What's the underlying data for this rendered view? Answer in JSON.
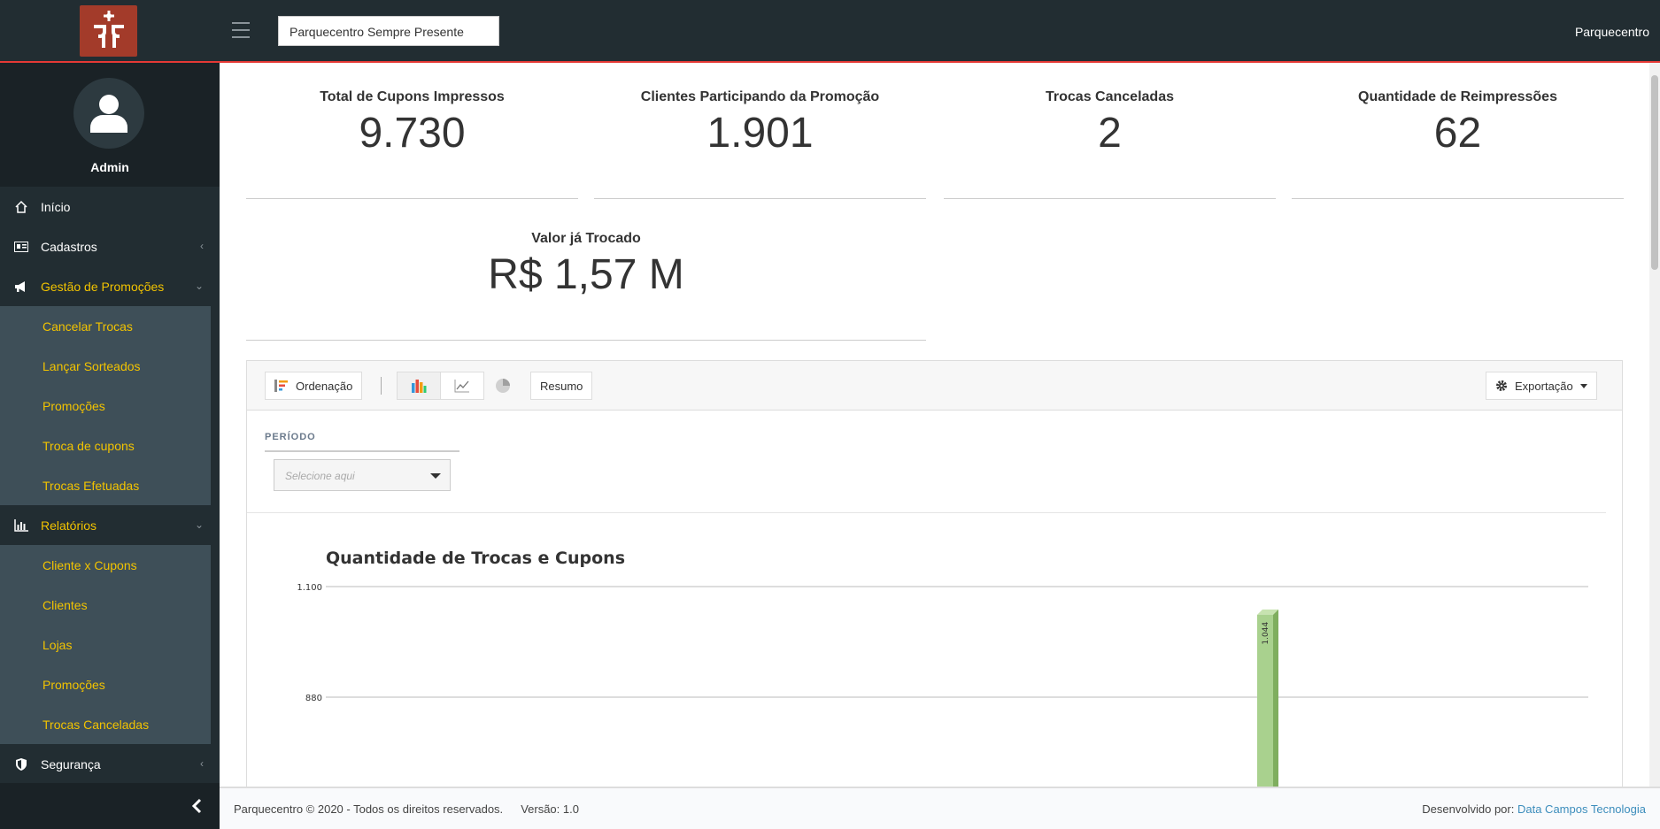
{
  "header": {
    "org_select": "Parquecentro Sempre Presente",
    "user_label": "Parquecentro"
  },
  "sidebar": {
    "user_name": "Admin",
    "items": [
      {
        "label": "Início",
        "icon": "home-icon",
        "expandable": false,
        "active": false
      },
      {
        "label": "Cadastros",
        "icon": "id-card-icon",
        "expandable": true,
        "active": false
      },
      {
        "label": "Gestão de Promoções",
        "icon": "megaphone-icon",
        "expandable": true,
        "active": true,
        "children": [
          "Cancelar Trocas",
          "Lançar Sorteados",
          "Promoções",
          "Troca de cupons",
          "Trocas Efetuadas"
        ]
      },
      {
        "label": "Relatórios",
        "icon": "bar-chart-icon",
        "expandable": true,
        "active": true,
        "children": [
          "Cliente x Cupons",
          "Clientes",
          "Lojas",
          "Promoções",
          "Trocas Canceladas"
        ]
      },
      {
        "label": "Segurança",
        "icon": "shield-icon",
        "expandable": true,
        "active": false
      }
    ]
  },
  "stats": [
    {
      "label": "Total de Cupons Impressos",
      "value": "9.730"
    },
    {
      "label": "Clientes Participando da Promoção",
      "value": "1.901"
    },
    {
      "label": "Trocas Canceladas",
      "value": "2"
    },
    {
      "label": "Quantidade de Reimpressões",
      "value": "62"
    },
    {
      "label": "Valor já Trocado",
      "value": "R$ 1,57 M"
    }
  ],
  "toolbar": {
    "ordenacao_label": "Ordenação",
    "resumo_label": "Resumo",
    "exportacao_label": "Exportação"
  },
  "filter": {
    "periodo_label": "PERÍODO",
    "periodo_placeholder": "Selecione aqui"
  },
  "chart_data": {
    "type": "bar",
    "title": "Quantidade de Trocas e Cupons",
    "ylim": [
      660,
      1100
    ],
    "yticks": [
      "1.100",
      "880"
    ],
    "grid": true,
    "bars": [
      {
        "value": 1044,
        "label": "1.044",
        "color": "#a9d18e"
      }
    ]
  },
  "footer": {
    "copyright": "Parquecentro © 2020 - Todos os direitos reservados.",
    "version": "Versão: 1.0",
    "dev_prefix": "Desenvolvido por:",
    "dev_link": "Data Campos Tecnologia"
  }
}
